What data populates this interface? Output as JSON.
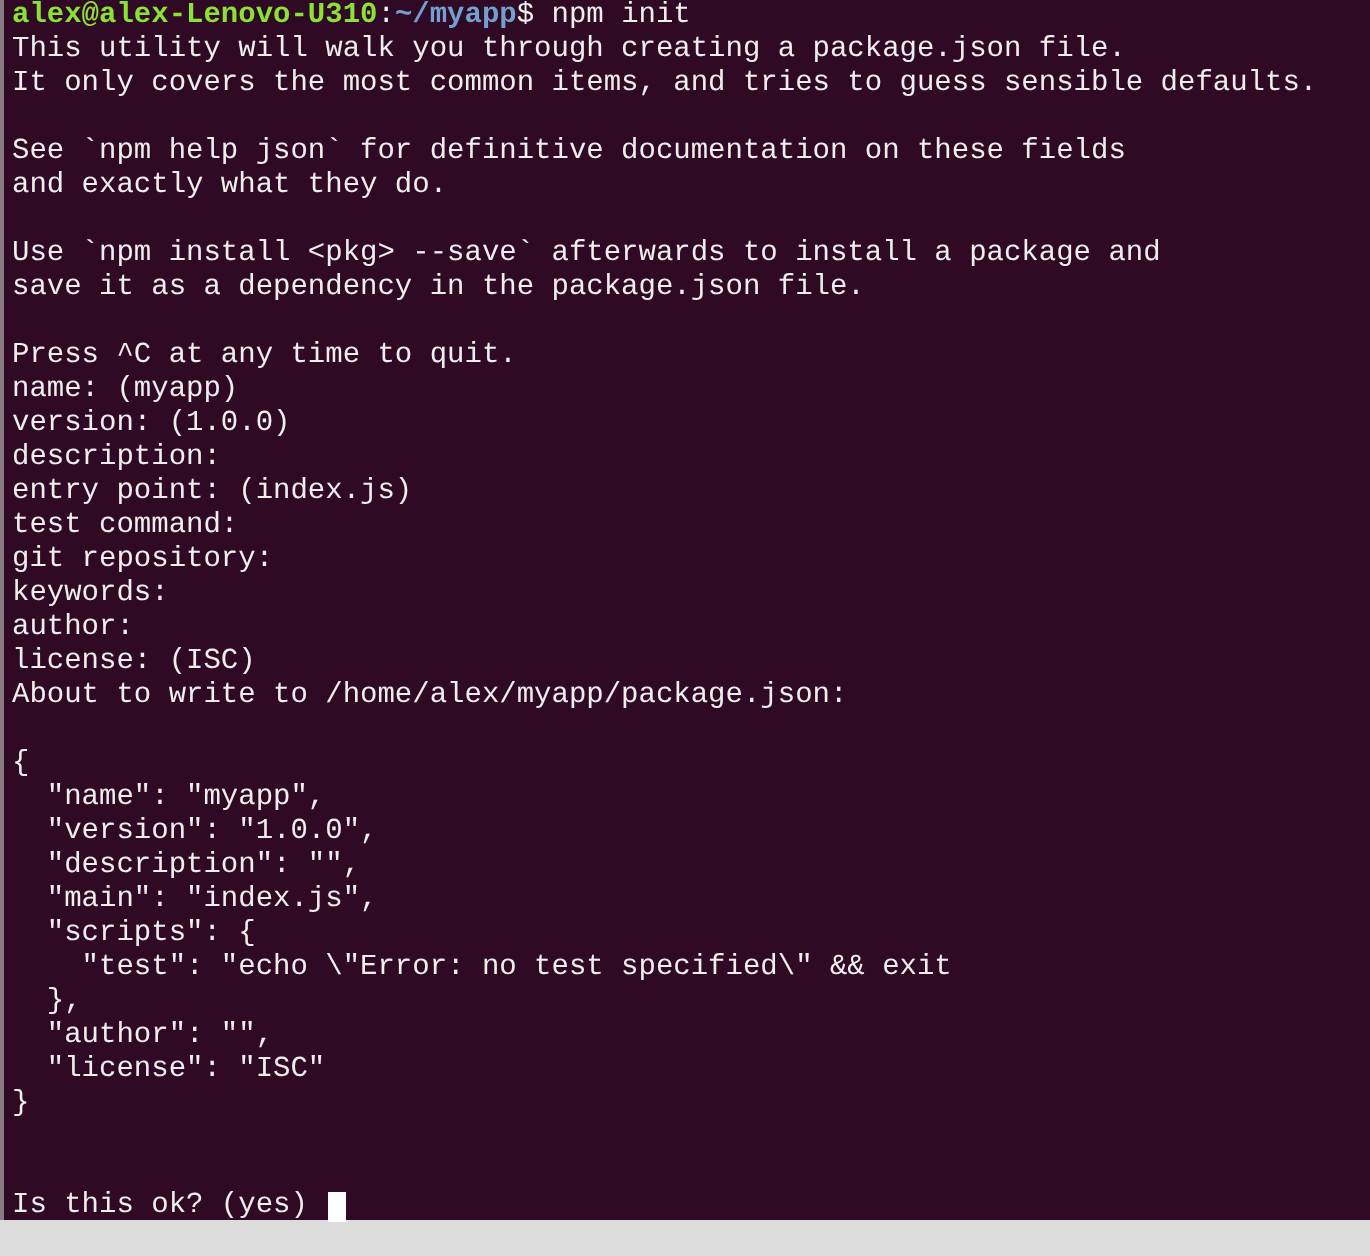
{
  "prompt": {
    "user_host": "alex@alex-Lenovo-U310",
    "separator": ":",
    "path": "~/myapp",
    "command": "$ npm init"
  },
  "blocks": [
    [
      "This utility will walk you through creating a package.json file.",
      "It only covers the most common items, and tries to guess sensible defaults."
    ],
    [
      "See `npm help json` for definitive documentation on these fields",
      "and exactly what they do."
    ],
    [
      "Use `npm install <pkg> --save` afterwards to install a package and",
      "save it as a dependency in the package.json file."
    ],
    [
      "Press ^C at any time to quit.",
      "name: (myapp)",
      "version: (1.0.0)",
      "description:",
      "entry point: (index.js)",
      "test command:",
      "git repository:",
      "keywords:",
      "author:",
      "license: (ISC)",
      "About to write to /home/alex/myapp/package.json:"
    ],
    [
      "{",
      "  \"name\": \"myapp\",",
      "  \"version\": \"1.0.0\",",
      "  \"description\": \"\",",
      "  \"main\": \"index.js\",",
      "  \"scripts\": {",
      "    \"test\": \"echo \\\"Error: no test specified\\\" && exit",
      "  },",
      "  \"author\": \"\",",
      "  \"license\": \"ISC\"",
      "}"
    ]
  ],
  "final_prompt": {
    "text": "Is this ok? (yes)",
    "cursor": true
  }
}
